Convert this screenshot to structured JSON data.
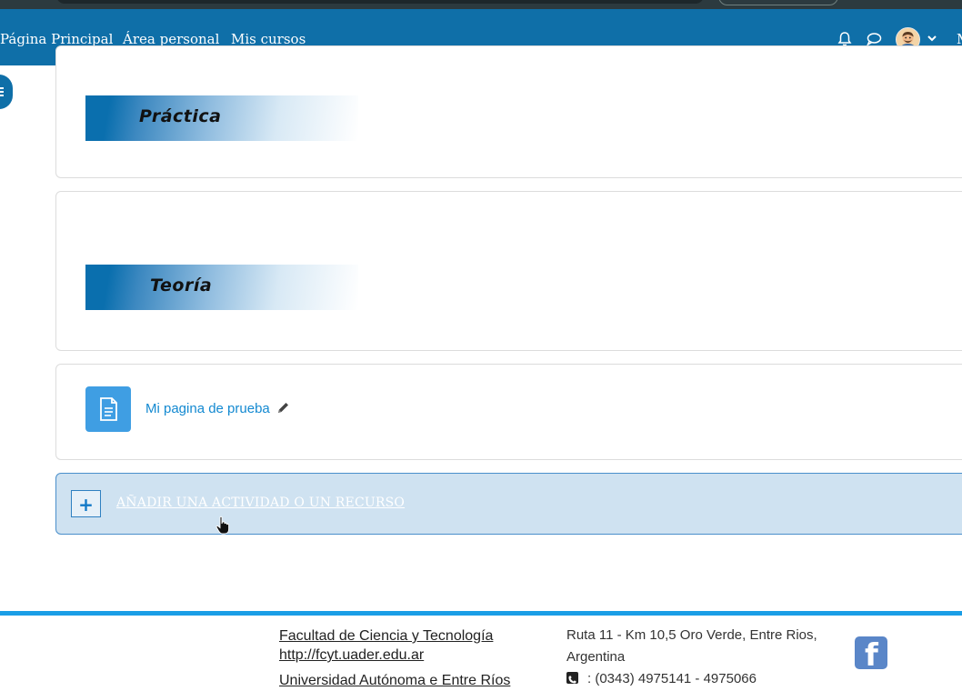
{
  "navbar": {
    "links": [
      "Página Principal",
      "Área personal",
      "Mis cursos"
    ],
    "overflow_label": "M"
  },
  "sections": [
    {
      "banner": "Práctica"
    },
    {
      "banner": "Teoría"
    }
  ],
  "activity": {
    "label": "Mi pagina de prueba",
    "icon": "page-icon"
  },
  "add_activity": {
    "plus": "+",
    "label": "AÑADIR UNA ACTIVIDAD O UN RECURSO"
  },
  "footer": {
    "faculty": "Facultad de Ciencia y Tecnología",
    "url": "http://fcyt.uader.edu.ar",
    "university": "Universidad Autónoma e Entre Ríos",
    "address": "Ruta 11 - Km 10,5 Oro Verde, Entre Rios,",
    "country": "Argentina",
    "phone": ": (0343) 4975141 - 4975066",
    "facebook_glyph": "f"
  },
  "colors": {
    "navbar": "#0f6fa8",
    "link": "#1389d1",
    "add_bg": "#cfe2f1",
    "footer_accent": "#1a9ee6"
  }
}
